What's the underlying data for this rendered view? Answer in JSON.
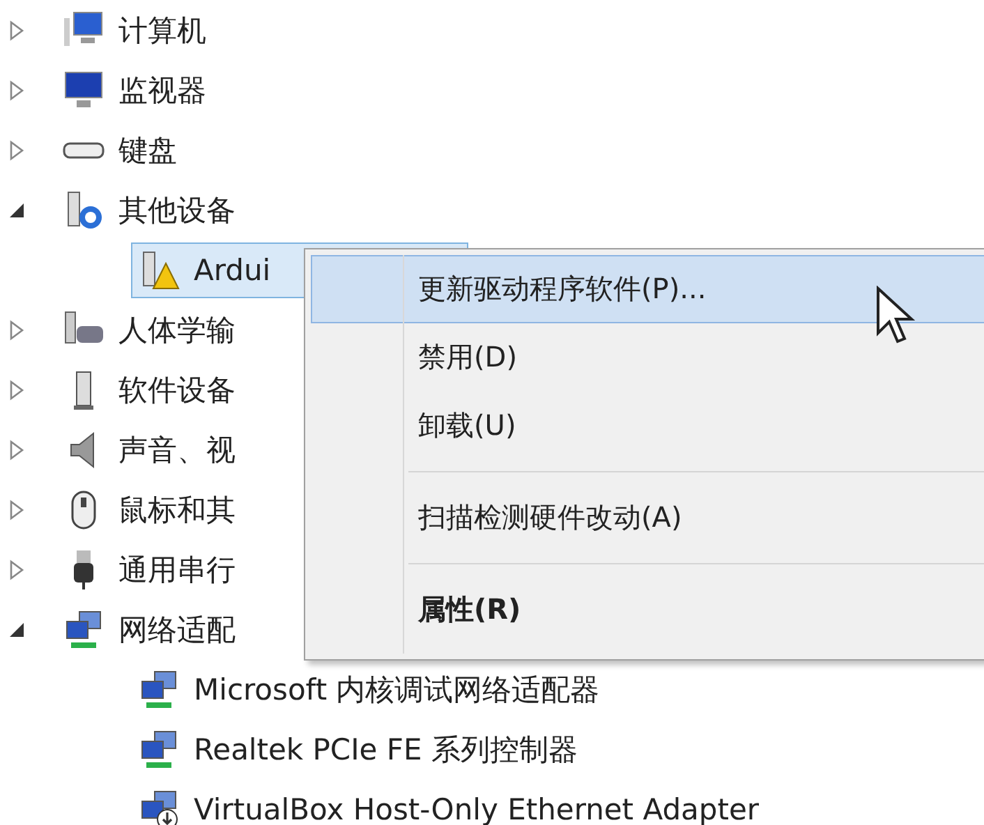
{
  "tree": [
    {
      "label": "计算机",
      "kind": "computer",
      "expanded": false
    },
    {
      "label": "监视器",
      "kind": "monitor",
      "expanded": false
    },
    {
      "label": "键盘",
      "kind": "keyboard",
      "expanded": false
    },
    {
      "label": "其他设备",
      "kind": "unknown",
      "expanded": true,
      "children": [
        {
          "label": "Ardui",
          "kind": "warning",
          "selected": true
        }
      ]
    },
    {
      "label": "人体学输",
      "kind": "hid",
      "expanded": false
    },
    {
      "label": "软件设备",
      "kind": "software",
      "expanded": false
    },
    {
      "label": "声音、视",
      "kind": "sound",
      "expanded": false
    },
    {
      "label": "鼠标和其",
      "kind": "mouse",
      "expanded": false
    },
    {
      "label": "通用串行",
      "kind": "usb",
      "expanded": false
    },
    {
      "label": "网络适配",
      "kind": "network",
      "expanded": true,
      "children": [
        {
          "label": "Microsoft 内核调试网络适配器",
          "kind": "network",
          "selected": false
        },
        {
          "label": "Realtek PCIe FE 系列控制器",
          "kind": "network",
          "selected": false
        },
        {
          "label": "VirtualBox Host-Only Ethernet Adapter",
          "kind": "network-down",
          "selected": false
        }
      ]
    }
  ],
  "context_menu": {
    "groups": [
      [
        {
          "label": "更新驱动程序软件(P)...",
          "selected": true,
          "default": false
        },
        {
          "label": "禁用(D)",
          "selected": false,
          "default": false
        },
        {
          "label": "卸载(U)",
          "selected": false,
          "default": false
        }
      ],
      [
        {
          "label": "扫描检测硬件改动(A)",
          "selected": false,
          "default": false
        }
      ],
      [
        {
          "label": "属性(R)",
          "selected": false,
          "default": true
        }
      ]
    ]
  }
}
